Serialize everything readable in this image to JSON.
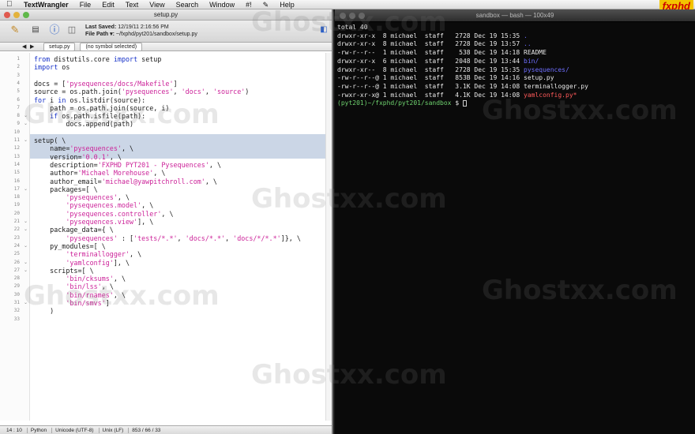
{
  "menubar": {
    "app_name": "TextWrangler",
    "items": [
      "File",
      "Edit",
      "Text",
      "View",
      "Search",
      "Window",
      "#!",
      "Help"
    ],
    "brand": "fxphd"
  },
  "editor": {
    "window_title": "setup.py",
    "last_saved_label": "Last Saved:",
    "last_saved_value": "12/19/11 2:16:56 PM",
    "file_path_label": "File Path ▾:",
    "file_path_value": "~/fxphd/pyt201/sandbox/setup.py",
    "file_tab": "setup.py",
    "symbol_menu": "(no symbol selected)",
    "line_numbers": [
      "1",
      "2",
      "3",
      "4",
      "5",
      "6",
      "7",
      "8",
      "9",
      "10",
      "11",
      "12",
      "13",
      "14",
      "15",
      "16",
      "17",
      "18",
      "19",
      "20",
      "21",
      "22",
      "23",
      "24",
      "25",
      "26",
      "27",
      "28",
      "29",
      "30",
      "31",
      "32",
      "33"
    ],
    "status": {
      "position": "14 : 10",
      "language": "Python",
      "encoding": "Unicode (UTF-8)",
      "line_endings": "Unix (LF)",
      "counts": "853 / 66 / 33"
    }
  },
  "code_lines": [
    "from distutils.core import setup",
    "import os",
    "",
    "docs = ['pysequences/docs/Makefile']",
    "source = os.path.join('pysequences', 'docs', 'source')",
    "for i in os.listdir(source):",
    "    path = os.path.join(source, i)",
    "    if os.path.isfile(path):",
    "        docs.append(path)",
    "",
    "setup( \\",
    "    name='pysequences', \\",
    "    version='0.0.1', \\",
    "    description='FXPHD PYT201 - Pysequences', \\",
    "    author='Michael Morehouse', \\",
    "    author_email='michael@yawpitchroll.com', \\",
    "    packages=[ \\",
    "        'pysequences', \\",
    "        'pysequences.model', \\",
    "        'pysequences.controller', \\",
    "        'pysequences.view'], \\",
    "    package_data={ \\",
    "        'pysequences' : ['tests/*.*', 'docs/*.*', 'docs/*/*.*']}, \\",
    "    py_modules=[ \\",
    "        'terminallogger', \\",
    "        'yamlconfig'], \\",
    "    scripts=[ \\",
    "        'bin/cksums', \\",
    "        'bin/lss', \\",
    "        'bin/rnames', \\",
    "        'bin/smvs']",
    "    )",
    ""
  ],
  "terminal": {
    "window_title": "sandbox — bash — 100x49",
    "lines": [
      {
        "text": "total 40",
        "cls": ""
      },
      {
        "perm": "drwxr-xr-x  8 michael  staff   2728 Dec 19 15:35 ",
        "name": ".",
        "cls": "dir"
      },
      {
        "perm": "drwxr-xr-x  8 michael  staff   2728 Dec 19 13:57 ",
        "name": "..",
        "cls": "dir"
      },
      {
        "perm": "-rw-r--r--  1 michael  staff    538 Dec 19 14:18 ",
        "name": "README",
        "cls": ""
      },
      {
        "perm": "drwxr-xr-x  6 michael  staff   2048 Dec 19 13:44 ",
        "name": "bin/",
        "cls": "dir"
      },
      {
        "perm": "drwxr-xr--  8 michael  staff   2728 Dec 19 15:35 ",
        "name": "pysequences/",
        "cls": "dir"
      },
      {
        "perm": "-rw-r--r--@ 1 michael  staff   853B Dec 19 14:16 ",
        "name": "setup.py",
        "cls": ""
      },
      {
        "perm": "-rw-r--r--@ 1 michael  staff   3.1K Dec 19 14:08 ",
        "name": "terminallogger.py",
        "cls": ""
      },
      {
        "perm": "-rwxr-xr-x@ 1 michael  staff   4.1K Dec 19 14:08 ",
        "name": "yamlconfig.py*",
        "cls": "red"
      }
    ],
    "prompt": "(pyt201)~/fxphd/pyt201/sandbox",
    "prompt_suffix": "$"
  },
  "watermark": "Ghostxx.com"
}
